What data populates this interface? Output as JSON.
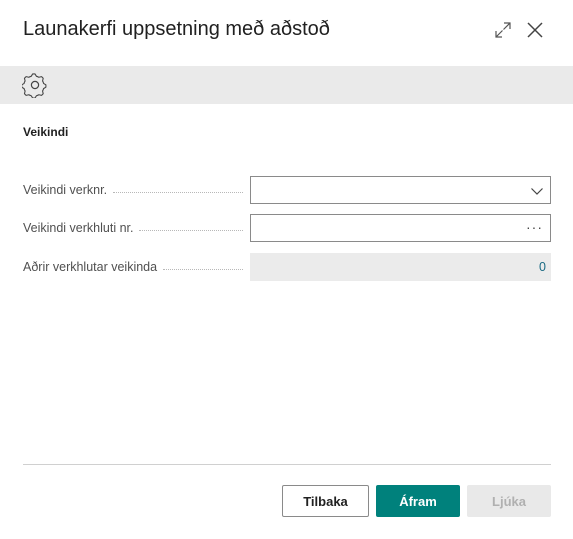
{
  "dialog": {
    "title": "Launakerfi uppsetning með aðstoð"
  },
  "icons": {
    "expand": "expand-icon",
    "close": "close-icon",
    "settings": "gear-icon"
  },
  "section": {
    "title": "Veikindi"
  },
  "fields": [
    {
      "label": "Veikindi verknr.",
      "value": "",
      "control": "dropdown"
    },
    {
      "label": "Veikindi verkhluti nr.",
      "value": "",
      "control": "lookup",
      "lookup_glyph": "···"
    },
    {
      "label": "Aðrir verkhlutar veikinda",
      "value": "0",
      "control": "readonly"
    }
  ],
  "buttons": {
    "back": "Tilbaka",
    "next": "Áfram",
    "finish": "Ljúka"
  },
  "colors": {
    "accent": "#00817c",
    "link_value": "#1a6a83",
    "action_bar": "#eaeaea"
  }
}
